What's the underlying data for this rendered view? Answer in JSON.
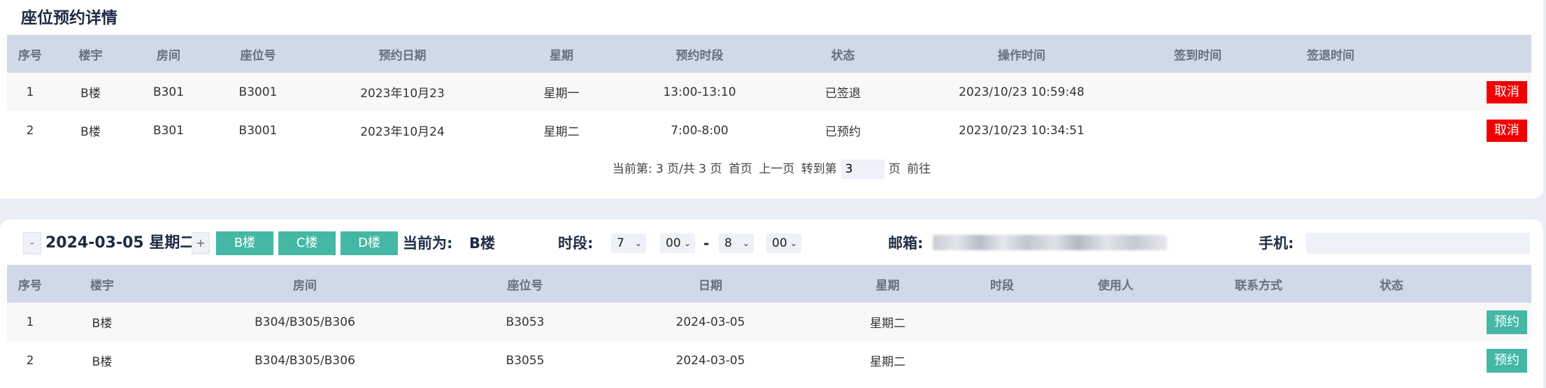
{
  "reservations": {
    "title": "座位预约详情",
    "headers": [
      "序号",
      "楼宇",
      "房间",
      "座位号",
      "预约日期",
      "星期",
      "预约时段",
      "状态",
      "操作时间",
      "签到时间",
      "签退时间",
      ""
    ],
    "rows": [
      {
        "idx": "1",
        "building": "B楼",
        "room": "B301",
        "seat": "B3001",
        "date": "2023年10月23",
        "weekday": "星期一",
        "slot": "13:00-13:10",
        "status": "已签退",
        "op_time": "2023/10/23 10:59:48",
        "checkin": "",
        "checkout": "",
        "action": "取消"
      },
      {
        "idx": "2",
        "building": "B楼",
        "room": "B301",
        "seat": "B3001",
        "date": "2023年10月24",
        "weekday": "星期二",
        "slot": "7:00-8:00",
        "status": "已预约",
        "op_time": "2023/10/23 10:34:51",
        "checkin": "",
        "checkout": "",
        "action": "取消"
      }
    ],
    "pager": {
      "info": "当前第: 3 页/共 3 页",
      "first": "首页",
      "prev": "上一页",
      "goto_label": "转到第",
      "goto_value": "3",
      "page_suffix": "页",
      "go": "前往"
    }
  },
  "booking": {
    "minus": "-",
    "date": "2024-03-05 星期二",
    "plus": "+",
    "buildings": [
      "B楼",
      "C楼",
      "D楼"
    ],
    "current_label": "当前为:",
    "current_value": "B楼",
    "slot_label": "时段:",
    "start_hour": "7",
    "start_min": "00",
    "dash": "-",
    "end_hour": "8",
    "end_min": "00",
    "email_label": "邮箱:",
    "phone_label": "手机:",
    "phone_value": "",
    "headers": [
      "序号",
      "楼宇",
      "房间",
      "座位号",
      "日期",
      "星期",
      "时段",
      "使用人",
      "联系方式",
      "状态",
      ""
    ],
    "rows": [
      {
        "idx": "1",
        "building": "B楼",
        "room": "B304/B305/B306",
        "seat": "B3053",
        "date": "2024-03-05",
        "weekday": "星期二",
        "slot": "",
        "user": "",
        "contact": "",
        "status": "",
        "action": "预约"
      },
      {
        "idx": "2",
        "building": "B楼",
        "room": "B304/B305/B306",
        "seat": "B3055",
        "date": "2024-03-05",
        "weekday": "星期二",
        "slot": "",
        "user": "",
        "contact": "",
        "status": "",
        "action": "预约"
      }
    ]
  }
}
